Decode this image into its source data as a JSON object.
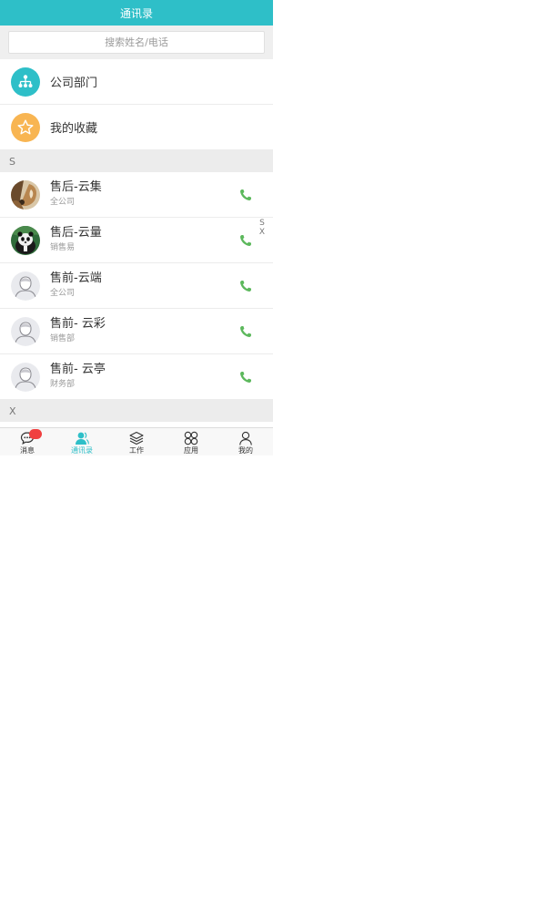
{
  "header": {
    "title": "通讯录"
  },
  "search": {
    "placeholder": "搜索姓名/电话"
  },
  "menu": [
    {
      "label": "公司部门",
      "icon": "org-chart-icon",
      "color": "#2ebfc8"
    },
    {
      "label": "我的收藏",
      "icon": "star-icon",
      "color": "#f8b552"
    }
  ],
  "sections": [
    {
      "letter": "S",
      "contacts": [
        {
          "name": "售后-云集",
          "dept": "全公司",
          "avatar": "photo-avatar-dog"
        },
        {
          "name": "售后-云量",
          "dept": "销售易",
          "avatar": "photo-avatar-panda"
        },
        {
          "name": "售前-云端",
          "dept": "全公司",
          "avatar": "default-avatar"
        },
        {
          "name": "售前- 云彩",
          "dept": "销售部",
          "avatar": "default-avatar"
        },
        {
          "name": "售前- 云亭",
          "dept": "财务部",
          "avatar": "default-avatar"
        }
      ]
    },
    {
      "letter": "X",
      "contacts": []
    }
  ],
  "index_bar": [
    "S",
    "X"
  ],
  "tabbar": {
    "active": "通讯录",
    "tabs": [
      {
        "label": "消息",
        "icon": "chat-icon",
        "badge": ""
      },
      {
        "label": "通讯录",
        "icon": "contacts-icon"
      },
      {
        "label": "工作",
        "icon": "layers-icon"
      },
      {
        "label": "应用",
        "icon": "apps-icon"
      },
      {
        "label": "我的",
        "icon": "user-icon"
      }
    ]
  },
  "colors": {
    "accent": "#2ebfc8",
    "phone": "#5cb85c",
    "badge": "#f04040",
    "star": "#f8b552"
  }
}
